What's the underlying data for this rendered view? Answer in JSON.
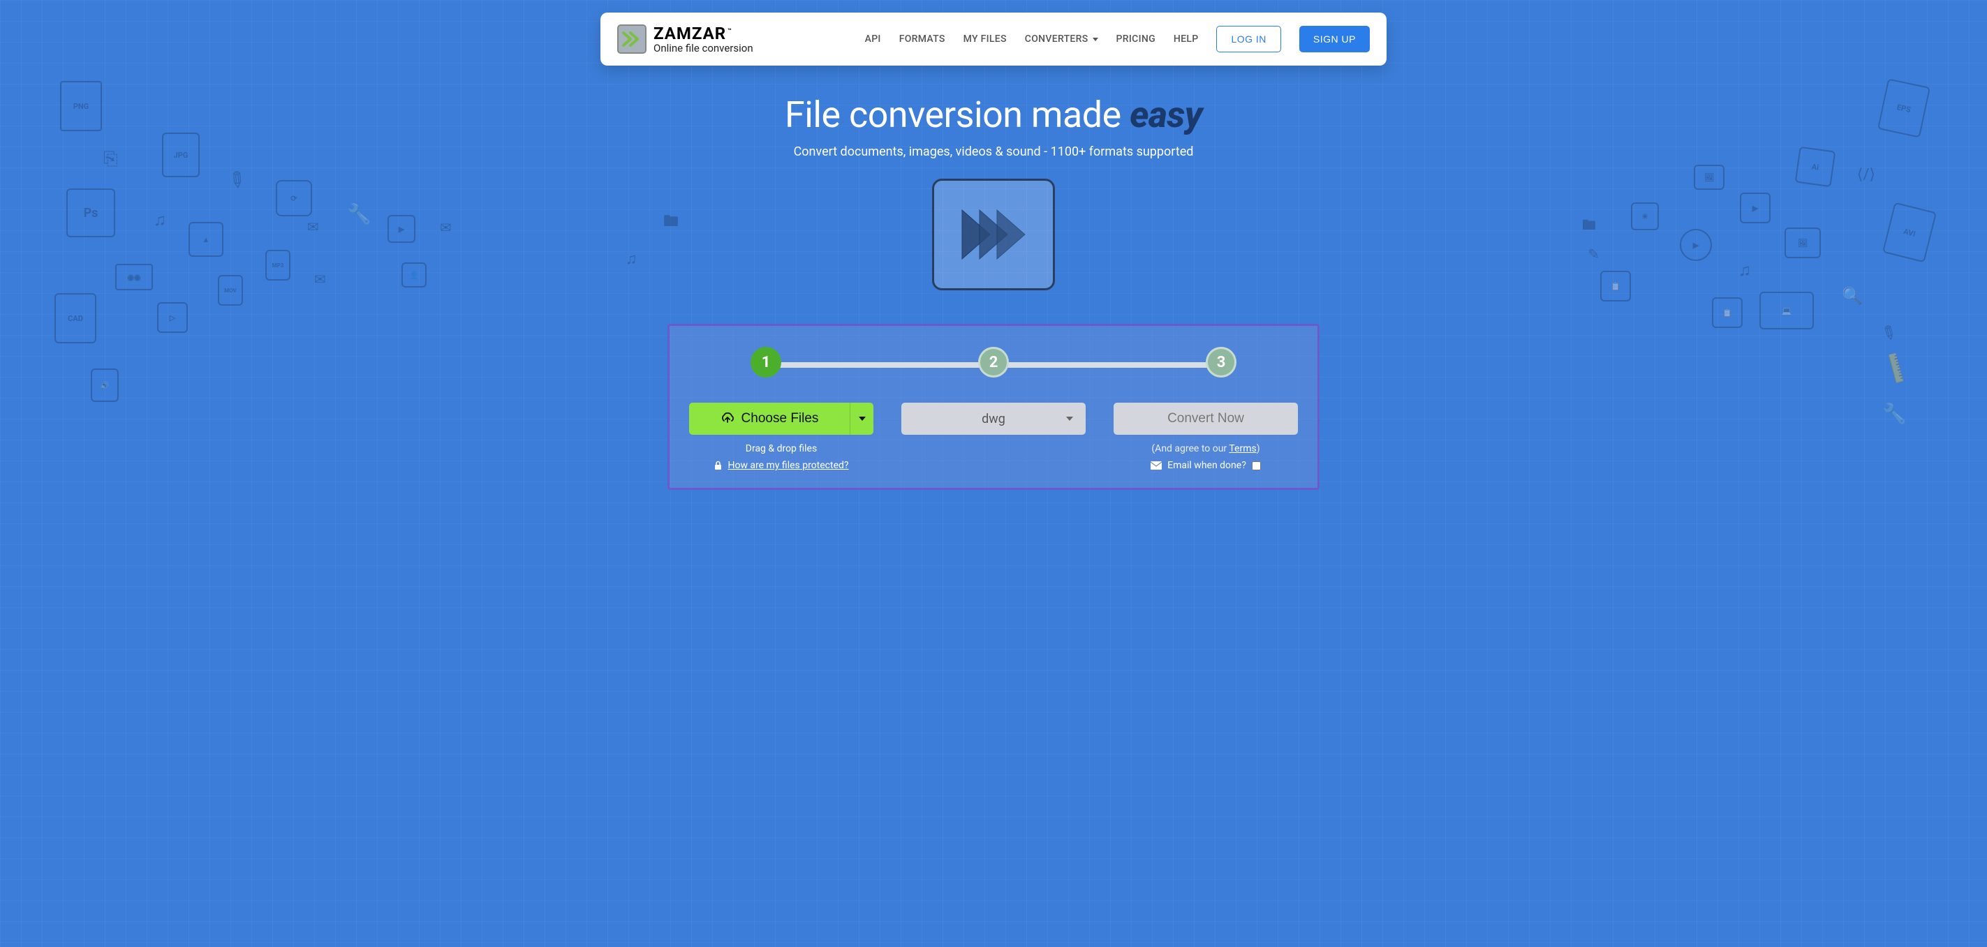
{
  "brand": {
    "name": "ZAMZAR",
    "tm": "™",
    "tagline": "Online file conversion"
  },
  "nav": {
    "api": "API",
    "formats": "FORMATS",
    "my_files": "MY FILES",
    "converters": "CONVERTERS",
    "pricing": "PRICING",
    "help": "HELP",
    "login": "LOG IN",
    "signup": "SIGN UP"
  },
  "hero": {
    "title_prefix": "File conversion made ",
    "title_emph": "easy",
    "subtitle": "Convert documents, images, videos & sound - 1100+ formats supported"
  },
  "steps": {
    "s1": "1",
    "s2": "2",
    "s3": "3"
  },
  "converter": {
    "choose_label": "Choose Files",
    "drag_hint": "Drag & drop files",
    "protect_link": "How are my files protected?",
    "format_selected": "dwg",
    "convert_label": "Convert Now",
    "terms_prefix": "(And agree to our ",
    "terms_link": "Terms",
    "terms_suffix": ")",
    "email_label": "Email when done?"
  }
}
